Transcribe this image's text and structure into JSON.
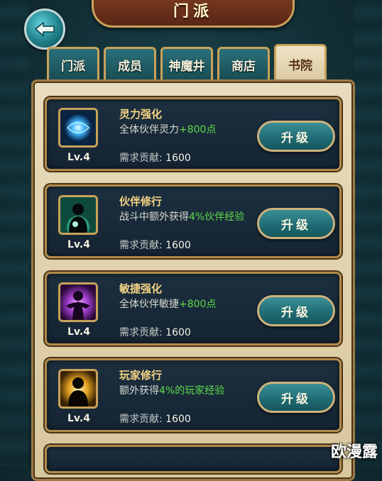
{
  "header": {
    "title": "门派"
  },
  "tabs": [
    {
      "label": "门派",
      "active": false
    },
    {
      "label": "成员",
      "active": false
    },
    {
      "label": "神魔井",
      "active": false
    },
    {
      "label": "商店",
      "active": false
    },
    {
      "label": "书院",
      "active": true
    }
  ],
  "skills": [
    {
      "name": "灵力强化",
      "desc_pre": "全体伙伴灵力",
      "desc_hl": "+800点",
      "desc_post": "",
      "cost_label": "需求贡献:",
      "cost_value": "1600",
      "level": "Lv.4",
      "button": "升级",
      "icon": "blue-orb-icon"
    },
    {
      "name": "伙伴修行",
      "desc_pre": "战斗中额外获得",
      "desc_hl": "4%伙伴经验",
      "desc_post": "",
      "cost_label": "需求贡献:",
      "cost_value": "1600",
      "level": "Lv.4",
      "button": "升级",
      "icon": "teal-silhouette-icon"
    },
    {
      "name": "敏捷强化",
      "desc_pre": "全体伙伴敏捷",
      "desc_hl": "+800点",
      "desc_post": "",
      "cost_label": "需求贡献:",
      "cost_value": "1600",
      "level": "Lv.4",
      "button": "升级",
      "icon": "purple-silhouette-icon"
    },
    {
      "name": "玩家修行",
      "desc_pre": "额外获得",
      "desc_hl": "4%的玩家经验",
      "desc_post": "",
      "cost_label": "需求贡献:",
      "cost_value": "1600",
      "level": "Lv.4",
      "button": "升级",
      "icon": "gold-silhouette-icon"
    }
  ],
  "watermark": "欧漫露",
  "colors": {
    "accent_gold": "#c9a25a",
    "highlight_green": "#5fdc4a",
    "skill_name": "#f4d484"
  }
}
